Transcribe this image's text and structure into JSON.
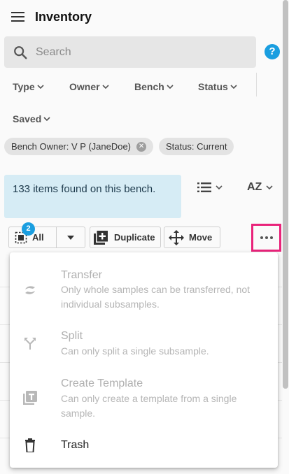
{
  "header": {
    "title": "Inventory"
  },
  "search": {
    "placeholder": "Search"
  },
  "help": {
    "label": "?"
  },
  "filters": {
    "type": "Type",
    "owner": "Owner",
    "bench": "Bench",
    "status": "Status",
    "saved": "Saved"
  },
  "chips": [
    {
      "label": "Bench Owner: V P (JaneDoe)",
      "closable": true
    },
    {
      "label": "Status: Current",
      "closable": false
    }
  ],
  "results": {
    "summary": "133 items found on this bench."
  },
  "sort": {
    "label": "AZ"
  },
  "toolbar": {
    "select_all_label": "All",
    "selected_count": "2",
    "duplicate_label": "Duplicate",
    "move_label": "Move"
  },
  "menu": {
    "items": [
      {
        "title": "Transfer",
        "description": "Only whole samples can be transferred, not individual subsamples.",
        "icon": "transfer-icon",
        "disabled": true
      },
      {
        "title": "Split",
        "description": "Can only split a single subsample.",
        "icon": "split-icon",
        "disabled": true
      },
      {
        "title": "Create Template",
        "description": "Can only create a template from a single sample.",
        "icon": "template-icon",
        "disabled": true
      },
      {
        "title": "Trash",
        "description": "",
        "icon": "trash-icon",
        "disabled": false
      }
    ]
  },
  "colors": {
    "accent": "#1a9ee0",
    "highlight_border": "#e9237a",
    "info_background": "#d6ecf5"
  }
}
